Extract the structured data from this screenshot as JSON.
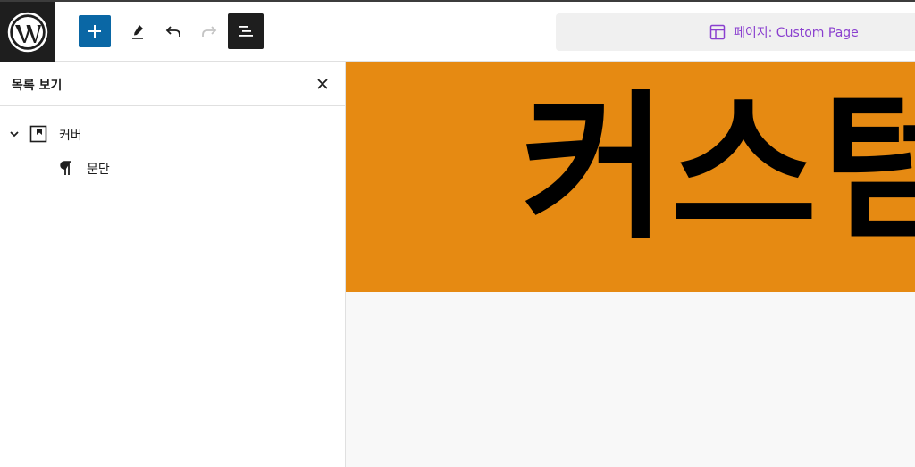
{
  "toolbar": {
    "add_button": "add-block",
    "edit_tool": "edit",
    "undo": "undo",
    "redo": "redo",
    "list_view": "document-overview",
    "document": {
      "label": "페이지: Custom Page",
      "icon": "layout-icon"
    }
  },
  "sidebar": {
    "title": "목록 보기",
    "close_icon": "close-icon",
    "items": [
      {
        "label": "커버",
        "icon": "cover-icon",
        "expanded": true
      },
      {
        "label": "문단",
        "icon": "paragraph-icon"
      }
    ]
  },
  "canvas": {
    "cover": {
      "heading": "커스텀",
      "background": "#e68a12"
    }
  },
  "colors": {
    "accent": "#0a67a5",
    "toolbar_dark": "#1e1e1e",
    "doc_label": "#8a3fcf"
  }
}
